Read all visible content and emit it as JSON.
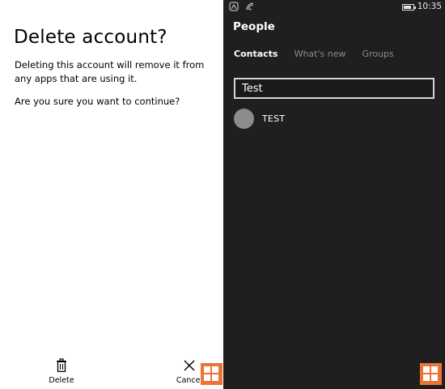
{
  "dialog": {
    "title": "Delete account?",
    "message": "Deleting this account will remove it from any apps that are using it.",
    "question": "Are you sure you want to continue?",
    "delete_label": "Delete",
    "cancel_label": "Cancel"
  },
  "phone": {
    "status": {
      "time": "10:35",
      "battery_level": 0.8
    },
    "app_title": "People",
    "pivots": [
      {
        "label": "Contacts",
        "active": true
      },
      {
        "label": "What's new",
        "active": false
      },
      {
        "label": "Groups",
        "active": false
      }
    ],
    "search_value": "Test",
    "contacts": [
      {
        "name": "TEST"
      }
    ]
  },
  "colors": {
    "dialog_bg": "#ffffff",
    "app_bg": "#1f1f1f",
    "avatar": "#8c8c8c",
    "watermark": "#ec7436"
  },
  "icons": [
    "trash-icon",
    "close-icon",
    "signal-icon",
    "wifi-icon",
    "battery-icon",
    "windows-logo-icon"
  ]
}
